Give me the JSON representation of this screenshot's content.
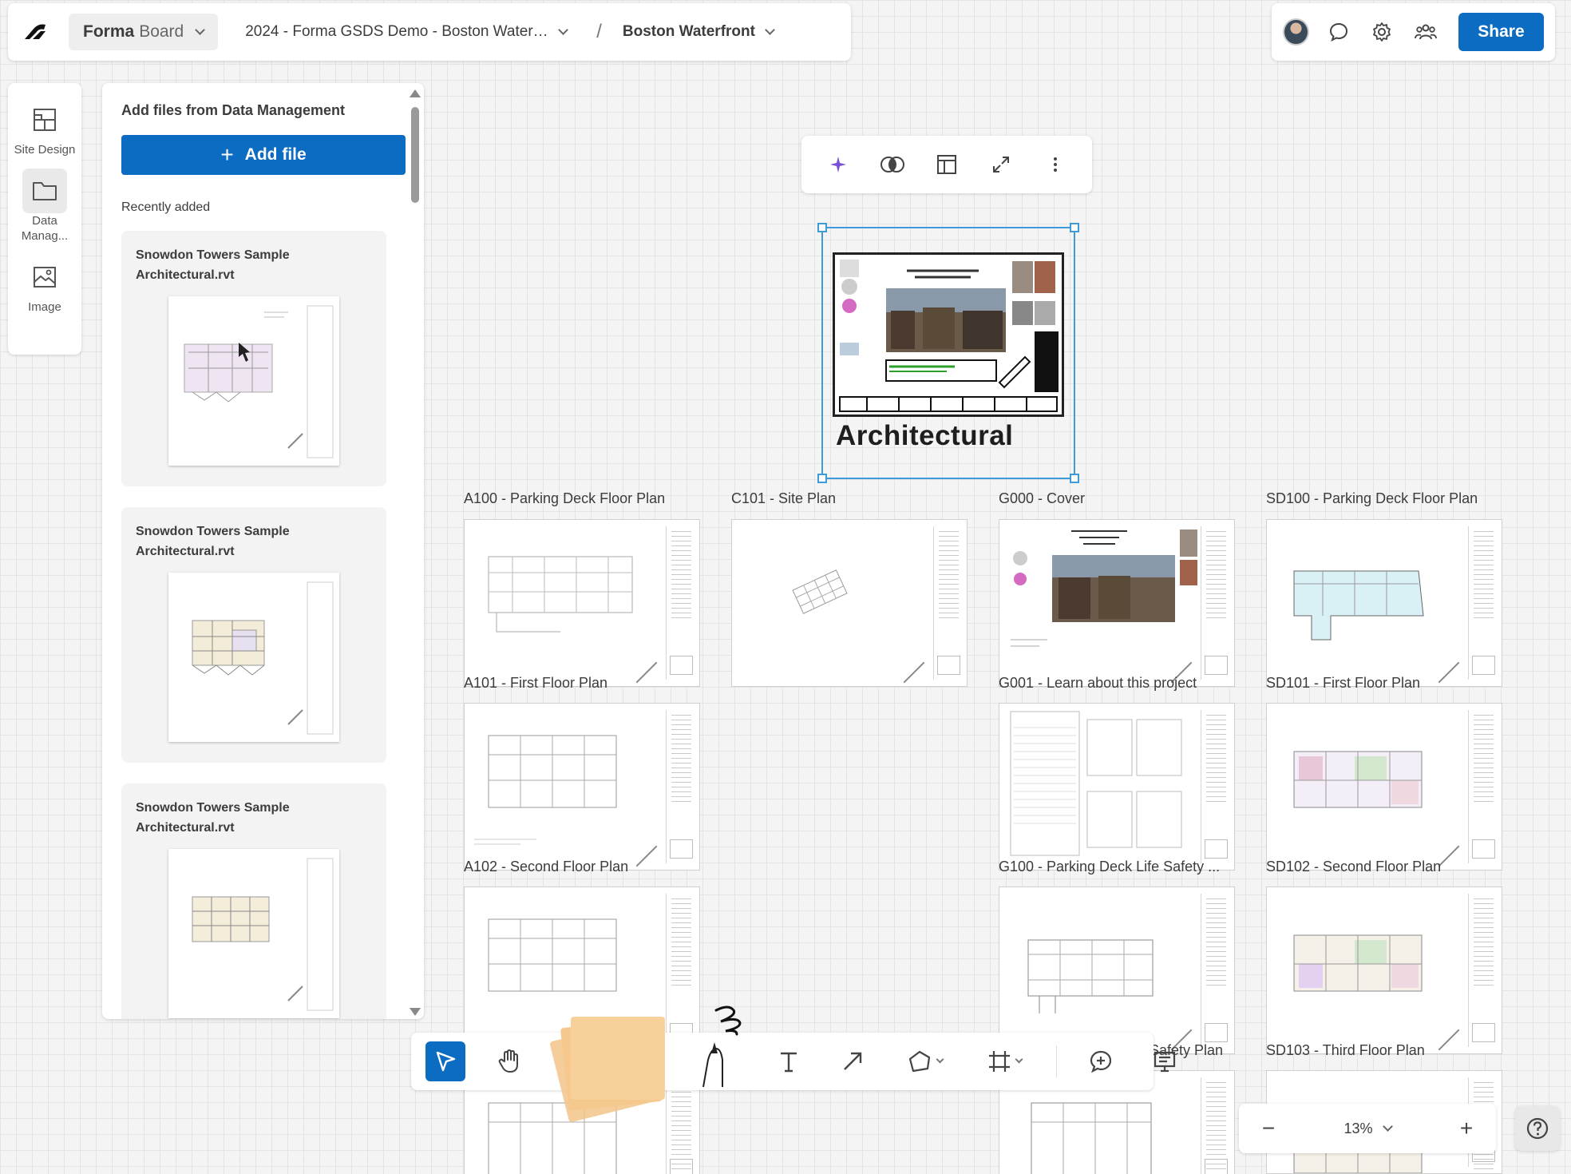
{
  "header": {
    "board_title_bold": "Forma",
    "board_title_rest": "Board",
    "project_name": "2024 - Forma GSDS Demo - Boston Waterf...",
    "breadcrumb_separator": "/",
    "site_name": "Boston Waterfront",
    "share_label": "Share"
  },
  "leftrail": {
    "items": [
      {
        "label": "Site Design",
        "icon": "site-design-icon"
      },
      {
        "label": "Data Manag...",
        "icon": "folder-icon"
      },
      {
        "label": "Image",
        "icon": "image-icon"
      }
    ]
  },
  "files_panel": {
    "title": "Add files from Data Management",
    "add_label": "Add file",
    "recent_label": "Recently added",
    "files": [
      {
        "name": "Snowdon Towers Sample Architectural.rvt"
      },
      {
        "name": "Snowdon Towers Sample Architectural.rvt"
      },
      {
        "name": "Snowdon Towers Sample Architectural.rvt"
      }
    ]
  },
  "selected_sheet": {
    "title": "Architectural"
  },
  "sheets": [
    {
      "label": "A100 - Parking Deck Floor Plan"
    },
    {
      "label": "C101 - Site Plan"
    },
    {
      "label": "G000 - Cover"
    },
    {
      "label": "SD100 - Parking Deck Floor Plan"
    },
    {
      "label": "A101 - First Floor Plan"
    },
    {
      "label": "G001 - Learn about this project"
    },
    {
      "label": "SD101 - First Floor Plan"
    },
    {
      "label": "A102 - Second Floor Plan"
    },
    {
      "label": "G100 - Parking Deck Life Safety ..."
    },
    {
      "label": "SD102 - Second Floor Plan"
    },
    {
      "label": "Safety Plan"
    },
    {
      "label": "SD103 - Third Floor Plan"
    }
  ],
  "zoom": {
    "level": "13%",
    "minus": "−",
    "plus": "+"
  },
  "colors": {
    "accent": "#0c6cc2",
    "selection": "#3c9bd8",
    "sticky": "#f7c98f"
  }
}
